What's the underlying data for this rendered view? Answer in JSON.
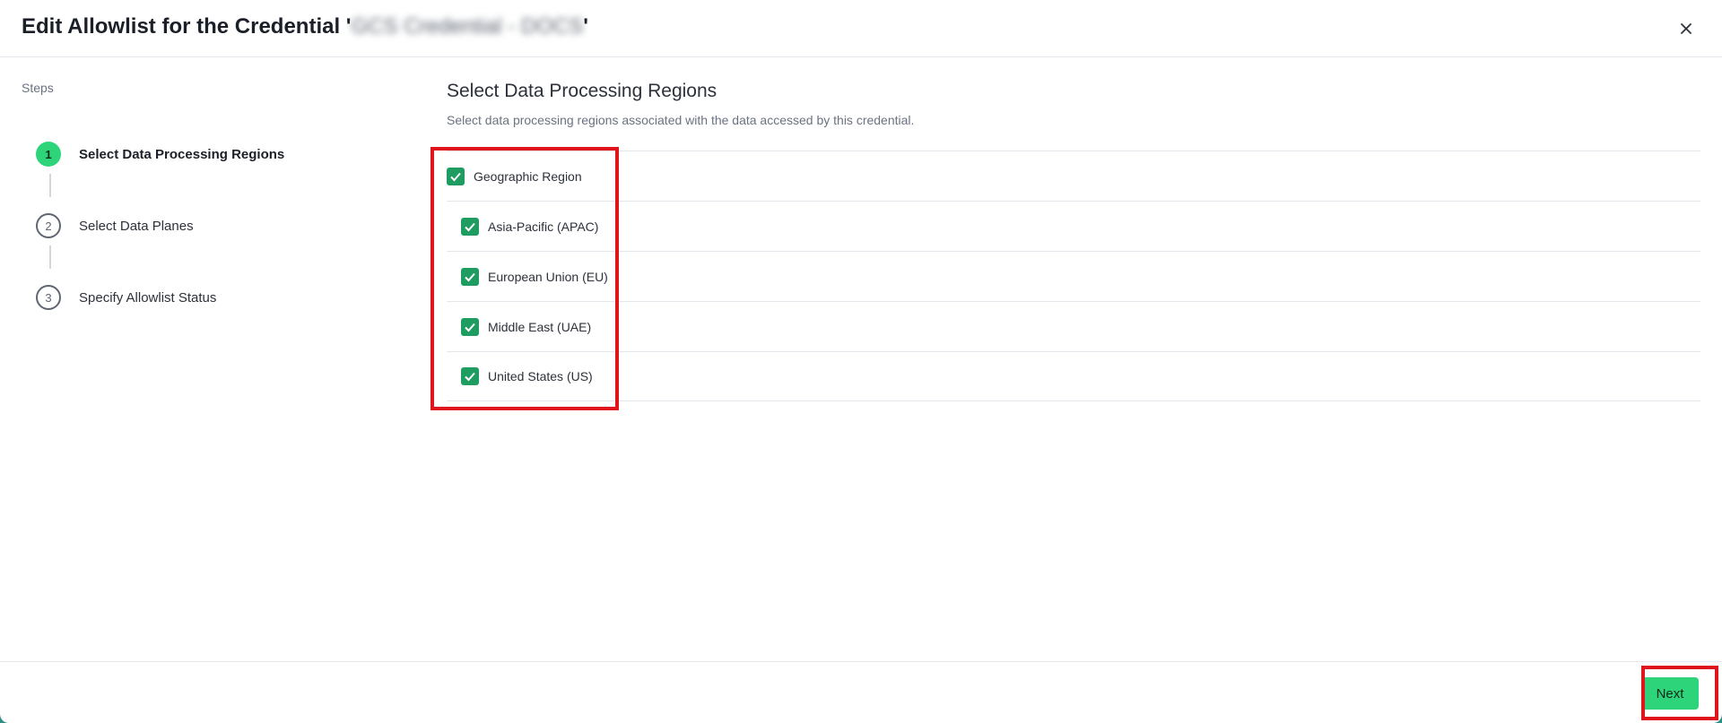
{
  "dialog": {
    "title_prefix": "Edit Allowlist for the Credential '",
    "title_name": "GCS Credential - DOCS",
    "title_suffix": "'"
  },
  "steps": {
    "heading": "Steps",
    "items": [
      {
        "number": "1",
        "label": "Select Data Processing Regions",
        "active": true
      },
      {
        "number": "2",
        "label": "Select Data Planes",
        "active": false
      },
      {
        "number": "3",
        "label": "Specify Allowlist Status",
        "active": false
      }
    ]
  },
  "main": {
    "title": "Select Data Processing Regions",
    "description": "Select data processing regions associated with the data accessed by this credential.",
    "regions": [
      {
        "label": "Geographic Region",
        "checked": true,
        "level": 0
      },
      {
        "label": "Asia-Pacific (APAC)",
        "checked": true,
        "level": 1
      },
      {
        "label": "European Union (EU)",
        "checked": true,
        "level": 1
      },
      {
        "label": "Middle East (UAE)",
        "checked": true,
        "level": 1
      },
      {
        "label": "United States (US)",
        "checked": true,
        "level": 1
      }
    ]
  },
  "footer": {
    "next_label": "Next"
  },
  "colors": {
    "accent": "#2ed47a",
    "checkbox": "#1f9d61",
    "highlight": "#e0141c"
  },
  "icons": {
    "close": "close-icon",
    "check": "check-icon"
  }
}
